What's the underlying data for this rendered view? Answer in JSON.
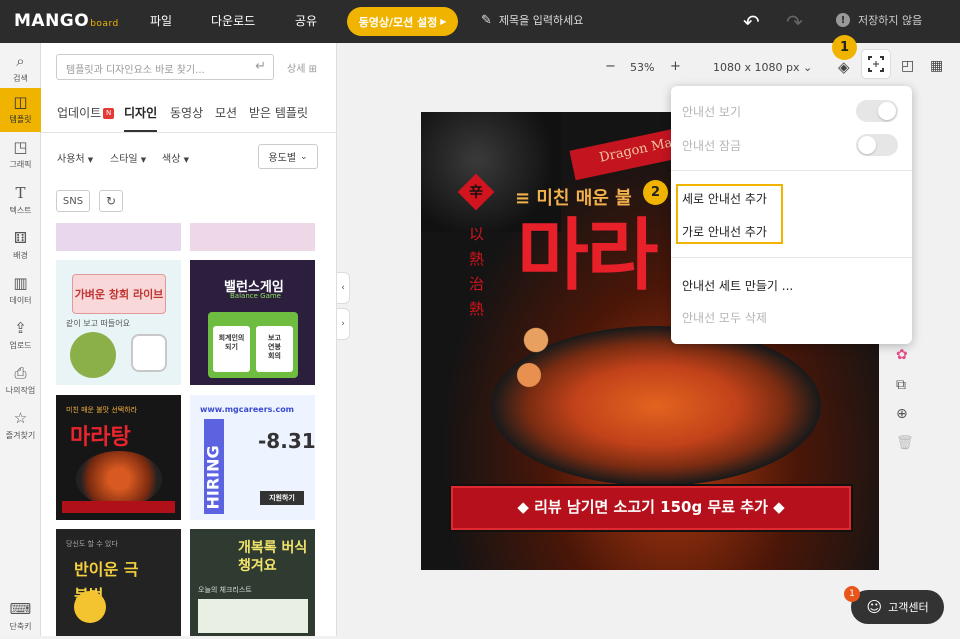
{
  "colors": {
    "accent": "#f0b400",
    "topbar": "#2c2c2c",
    "canvas_red": "#d2141e",
    "dark": "#111111"
  },
  "topbar": {
    "logo": "MANGO",
    "logo_sub": "board",
    "menu": [
      "파일",
      "다운로드",
      "공유"
    ],
    "motion_button": "동영상/모션 설정",
    "title_placeholder": "제목을 입력하세요",
    "save_status": "저장하지 않음"
  },
  "leftnav": {
    "items": [
      {
        "label": "검색",
        "icon": "search-icon"
      },
      {
        "label": "템플릿",
        "icon": "template-icon"
      },
      {
        "label": "그래픽",
        "icon": "graphic-icon"
      },
      {
        "label": "텍스트",
        "icon": "text-icon"
      },
      {
        "label": "배경",
        "icon": "background-icon"
      },
      {
        "label": "데이터",
        "icon": "data-icon"
      },
      {
        "label": "업로드",
        "icon": "upload-icon"
      },
      {
        "label": "나의작업",
        "icon": "my-work-icon"
      },
      {
        "label": "즐겨찾기",
        "icon": "star-icon"
      },
      {
        "label": "단축키",
        "icon": "keyboard-icon"
      }
    ]
  },
  "panel": {
    "search_placeholder": "템플릿과 디자인요소 바로 찾기...",
    "detail": "상세",
    "tabs": [
      "업데이트",
      "디자인",
      "동영상",
      "모션",
      "받은 템플릿"
    ],
    "new_badge": "N",
    "filters": [
      "사용처",
      "스타일",
      "색상"
    ],
    "sort": "용도별",
    "chip": "SNS",
    "thumbnails": [
      {
        "title": "가벼운 창회 라이브",
        "subtitle": "같이 보고 떠들어요"
      },
      {
        "title": "밸런스게임",
        "subtitle": "Balance Game",
        "extra": [
          "회계인의",
          "보고",
          "연봉",
          "되기",
          "회의"
        ]
      },
      {
        "title": "마라탕",
        "subtitle": "미친 매운 불맛 선택하라"
      },
      {
        "title": "HIRING",
        "subtitle": "www.mgcareers.com",
        "extra": "-8.31",
        "badge": "지원하기"
      },
      {
        "title": "반이운 극복법",
        "subtitle": "당신도 할 수 있다"
      },
      {
        "title": "개복록 버식 챙겨요",
        "subtitle": "오늘의 체크리스트"
      }
    ]
  },
  "toolbar": {
    "zoom_minus": "−",
    "zoom": "53%",
    "zoom_plus": "+",
    "size": "1080 x 1080 px"
  },
  "dropdown": {
    "show_guides": "안내선 보기",
    "lock_guides": "안내선 잠금",
    "add_vertical": "세로 안내선 추가",
    "add_horizontal": "가로 안내선 추가",
    "make_set": "안내선 세트 만들기 ...",
    "delete_all": "안내선 모두 삭제"
  },
  "steps": [
    "1",
    "2"
  ],
  "canvas": {
    "banner": "Dragon Ma",
    "seal": "辛",
    "vertical": [
      "以",
      "熱",
      "治",
      "熱"
    ],
    "subtitle": "미친 매운 불",
    "title": "마라",
    "bottom": "리뷰 남기면 소고기 150g 무료 추가"
  },
  "help": {
    "label": "고객센터",
    "badge": "1"
  }
}
